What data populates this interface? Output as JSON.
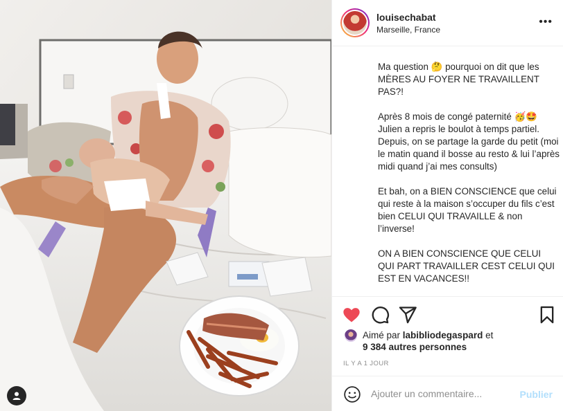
{
  "post": {
    "username": "louisechabat",
    "location": "Marseille, France",
    "more_icon": "more-horizontal-icon",
    "caption": [
      "Ma question 🤔 pourquoi on dit que les MÈRES AU FOYER NE TRAVAILLENT PAS?!",
      "Après 8 mois de congé paternité 🥳🤩 Julien a repris le boulot à temps partiel. Depuis, on se partage la garde du petit (moi le matin quand il bosse au resto & lui l’après midi quand j’ai mes consults)",
      "Et bah, on a BIEN CONSCIENCE que celui qui reste à la maison s’occuper du fils c’est bien CELUI QUI TRAVAILLE & non l’inverse!",
      "ON A BIEN CONSCIENCE QUE CELUI QUI PART TRAVAILLER CEST CELUI QUI EST EN VACANCES!!"
    ]
  },
  "actions": {
    "like_icon": "heart-filled-icon",
    "comment_icon": "comment-bubble-icon",
    "share_icon": "send-paper-plane-icon",
    "save_icon": "bookmark-icon",
    "like_color": "#ed4956"
  },
  "likes": {
    "prefix": "Aimé par",
    "user": "labibliodegaspard",
    "suffix": "et",
    "others": "9 384 autres personnes"
  },
  "time_ago": "IL Y A 1 JOUR",
  "comment": {
    "placeholder": "Ajouter un commentaire...",
    "publish_label": "Publier",
    "emoji_icon": "smiley-face-icon"
  },
  "photo": {
    "tag_icon": "user-tag-icon"
  }
}
